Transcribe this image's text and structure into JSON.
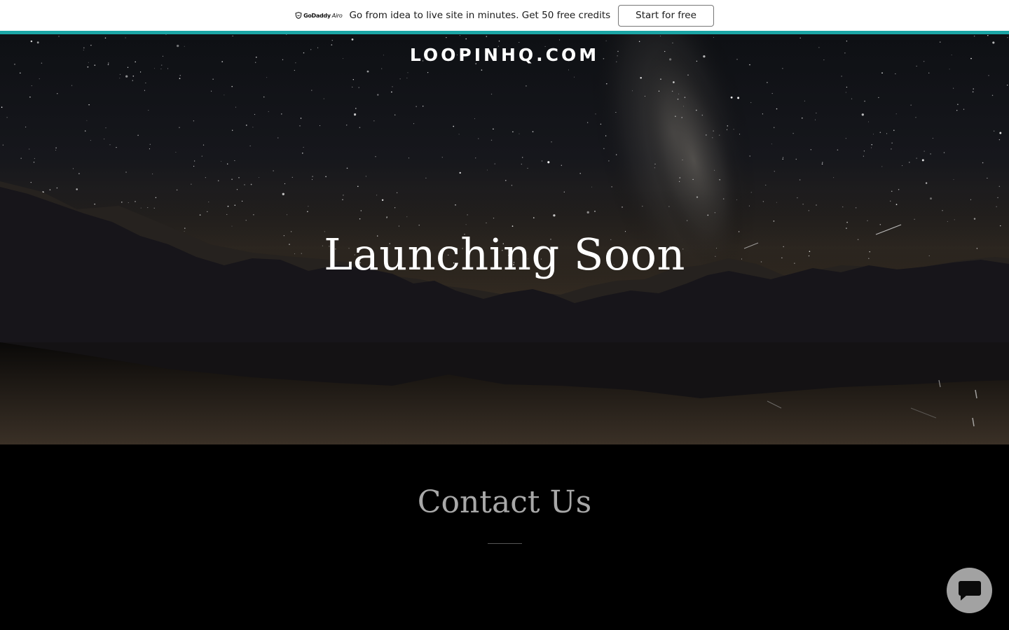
{
  "promo": {
    "logo_brand": "GoDaddy",
    "logo_product": "Airo",
    "message": "Go from idea to live site in minutes. Get 50 free credits",
    "cta_label": "Start for free"
  },
  "header": {
    "site_title": "LOOPINHQ.COM"
  },
  "hero": {
    "heading": "Launching Soon"
  },
  "contact": {
    "heading": "Contact Us"
  },
  "chat": {
    "icon": "chat-bubble-icon"
  },
  "colors": {
    "promo_border": "#1BA5A5",
    "chat_button": "#A2A2A2",
    "contact_heading": "#A8A8A8"
  }
}
